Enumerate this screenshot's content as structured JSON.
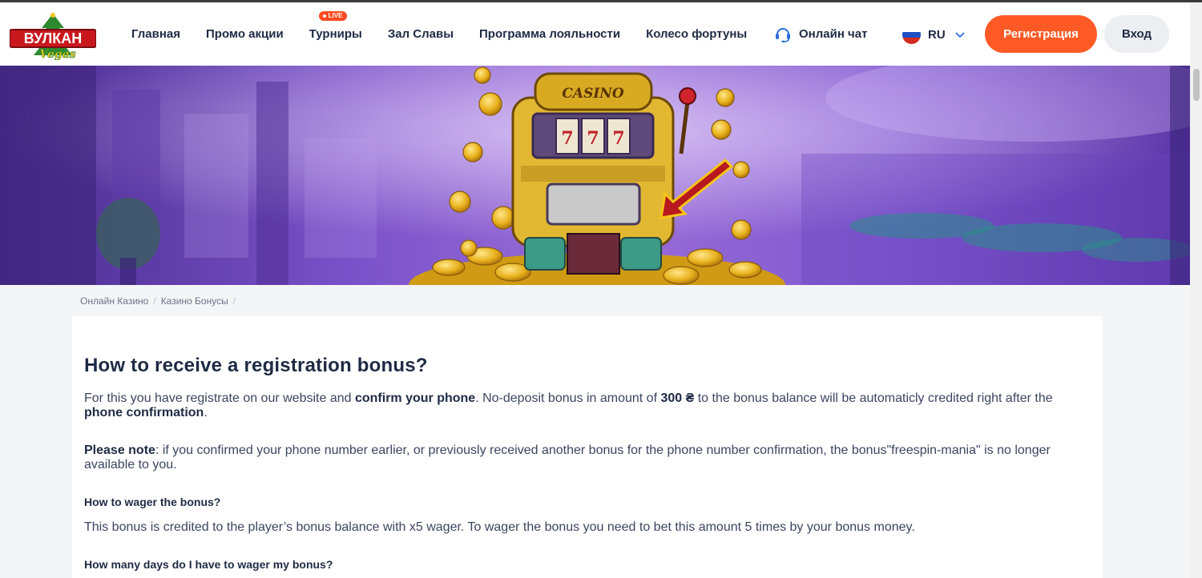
{
  "header": {
    "logo_text": "ВУЛКАН Vegas",
    "nav": [
      {
        "label": "Главная"
      },
      {
        "label": "Промо акции"
      },
      {
        "label": "Турниры",
        "badge": "LIVE"
      },
      {
        "label": "Зал Славы"
      },
      {
        "label": "Программа лояльности"
      },
      {
        "label": "Колесо фортуны"
      }
    ],
    "chat_label": "Онлайн чат",
    "language": "RU",
    "register_label": "Регистрация",
    "login_label": "Вход"
  },
  "banner": {
    "slot_label": "CASINO",
    "reels": [
      "7",
      "7",
      "7"
    ]
  },
  "breadcrumbs": {
    "items": [
      "Онлайн Казино",
      "Казино Бонусы"
    ],
    "separator": "/"
  },
  "content": {
    "title": "How to receive a registration bonus?",
    "p1_a": "For this you have registrate on our website and ",
    "p1_b": "confirm your phone",
    "p1_c": ". No-deposit bonus in amount of ",
    "p1_d": "300 ₴",
    "p1_e": " to the bonus balance will be automaticly credited right after the ",
    "p1_f": "phone confirmation",
    "p1_g": ".",
    "p2_a": "Please note",
    "p2_b": ": if you confirmed your phone number earlier, or previously received another bonus for the phone number confirmation, the bonus\"freespin-mania\" is no longer available to you.",
    "h_wager": "How to wager the bonus?",
    "p3": "This bonus is credited to the player’s bonus balance with x5 wager. To wager the bonus you need to bet this amount 5 times by your bonus money.",
    "h_days": "How many days do I have to wager my bonus?"
  },
  "colors": {
    "accent": "#ff5a26",
    "text_dark": "#1f2a44",
    "banner_purple": "#6a3fb0"
  }
}
